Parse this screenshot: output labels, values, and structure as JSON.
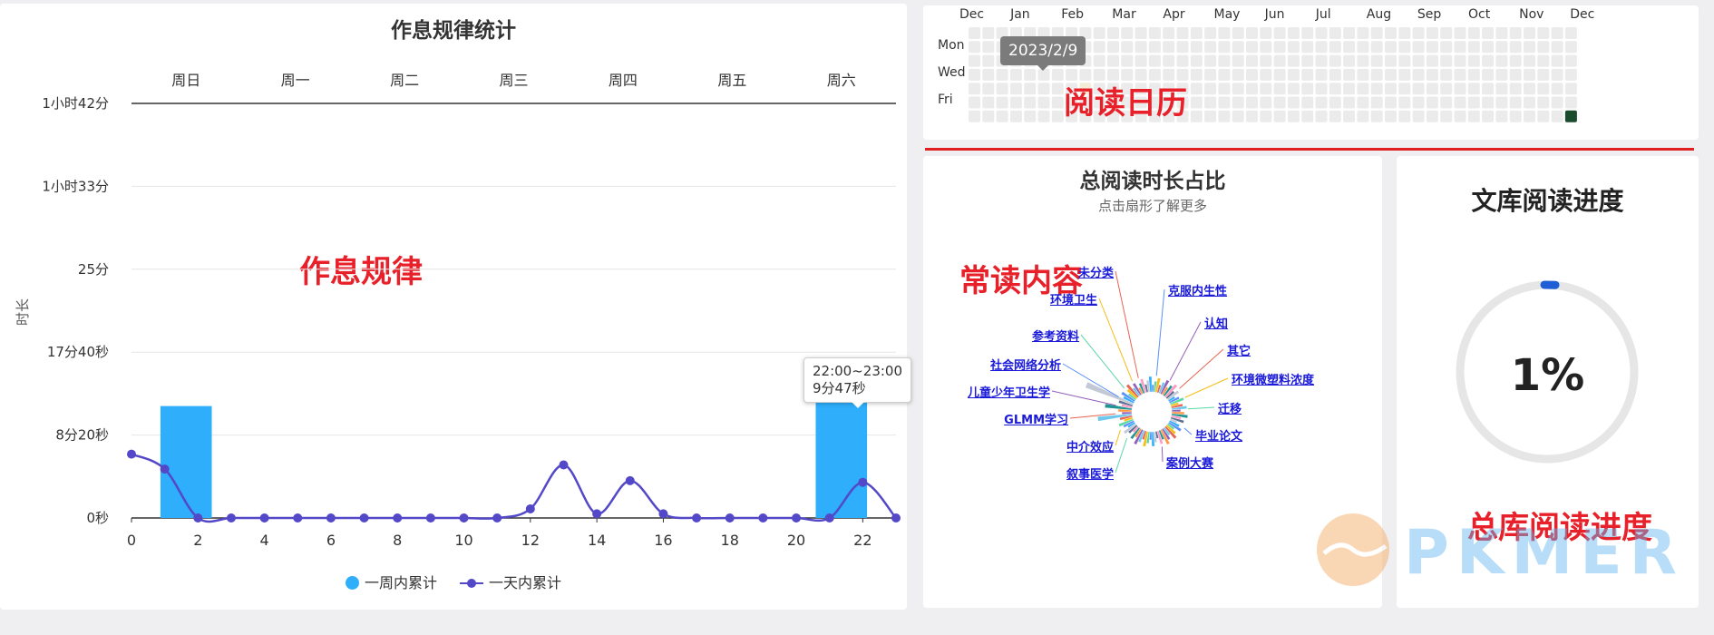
{
  "activity": {
    "title": "作息规律统计",
    "annotation": "作息规律",
    "ylabel": "时长",
    "tooltip": {
      "range": "22:00~23:00",
      "value": "9分47秒"
    },
    "legend": [
      {
        "label": "一周内累计",
        "color": "#2eaefb"
      },
      {
        "label": "一天内累计",
        "color": "#5348c8"
      }
    ]
  },
  "chart_data": [
    {
      "type": "bar",
      "title": "作息规律统计",
      "ylabel": "时长",
      "categories": [
        "周日",
        "周一",
        "周二",
        "周三",
        "周四",
        "周五",
        "周六"
      ],
      "y_tick_labels": [
        "0秒",
        "8分20秒",
        "17分40秒",
        "25分",
        "1小时33分",
        "1小时42分"
      ],
      "series": [
        {
          "name": "一周内累计",
          "color": "#2eaefb",
          "values": [
            1.35,
            0,
            0,
            0,
            0,
            0,
            1.75
          ]
        }
      ]
    },
    {
      "type": "line",
      "ylabel": "时长",
      "x": [
        0,
        1,
        2,
        3,
        4,
        5,
        6,
        7,
        8,
        9,
        10,
        11,
        12,
        13,
        14,
        15,
        16,
        17,
        18,
        19,
        20,
        21,
        22,
        23
      ],
      "x_ticks": [
        0,
        2,
        4,
        6,
        8,
        10,
        12,
        14,
        16,
        18,
        20,
        22
      ],
      "series": [
        {
          "name": "一天内累计",
          "color": "#5348c8",
          "values": [
            0.77,
            0.59,
            0,
            0,
            0,
            0,
            0,
            0,
            0,
            0,
            0,
            0,
            0.11,
            0.64,
            0.05,
            0.45,
            0.05,
            0,
            0,
            0,
            0,
            0,
            0.43,
            0
          ]
        }
      ]
    }
  ],
  "calendar": {
    "annotation": "阅读日历",
    "months": [
      "Dec",
      "Jan",
      "Feb",
      "Mar",
      "Apr",
      "May",
      "Jun",
      "Jul",
      "Aug",
      "Sep",
      "Oct",
      "Nov",
      "Dec"
    ],
    "days": [
      "Mon",
      "Wed",
      "Fri"
    ],
    "tooltip": "2023/2/9",
    "cell_color": "#ebebeb",
    "active_color": "#1a4d2e"
  },
  "pie": {
    "title": "总阅读时长占比",
    "subtitle": "点击扇形了解更多",
    "annotation": "常读内容",
    "labels": [
      "未分类",
      "克服内生性",
      "环境卫生",
      "认知",
      "参考资料",
      "其它",
      "社会网络分析",
      "环境微塑料浓度",
      "儿童少年卫生学",
      "迁移",
      "GLMM学习",
      "毕业论文",
      "中介效应",
      "案例大赛",
      "叙事医学"
    ]
  },
  "progress": {
    "title": "文库阅读进度",
    "value_text": "1%",
    "value": 0.01,
    "annotation": "总库阅读进度",
    "color": "#1e5fd6"
  },
  "watermark": {
    "text": "PKMER"
  }
}
